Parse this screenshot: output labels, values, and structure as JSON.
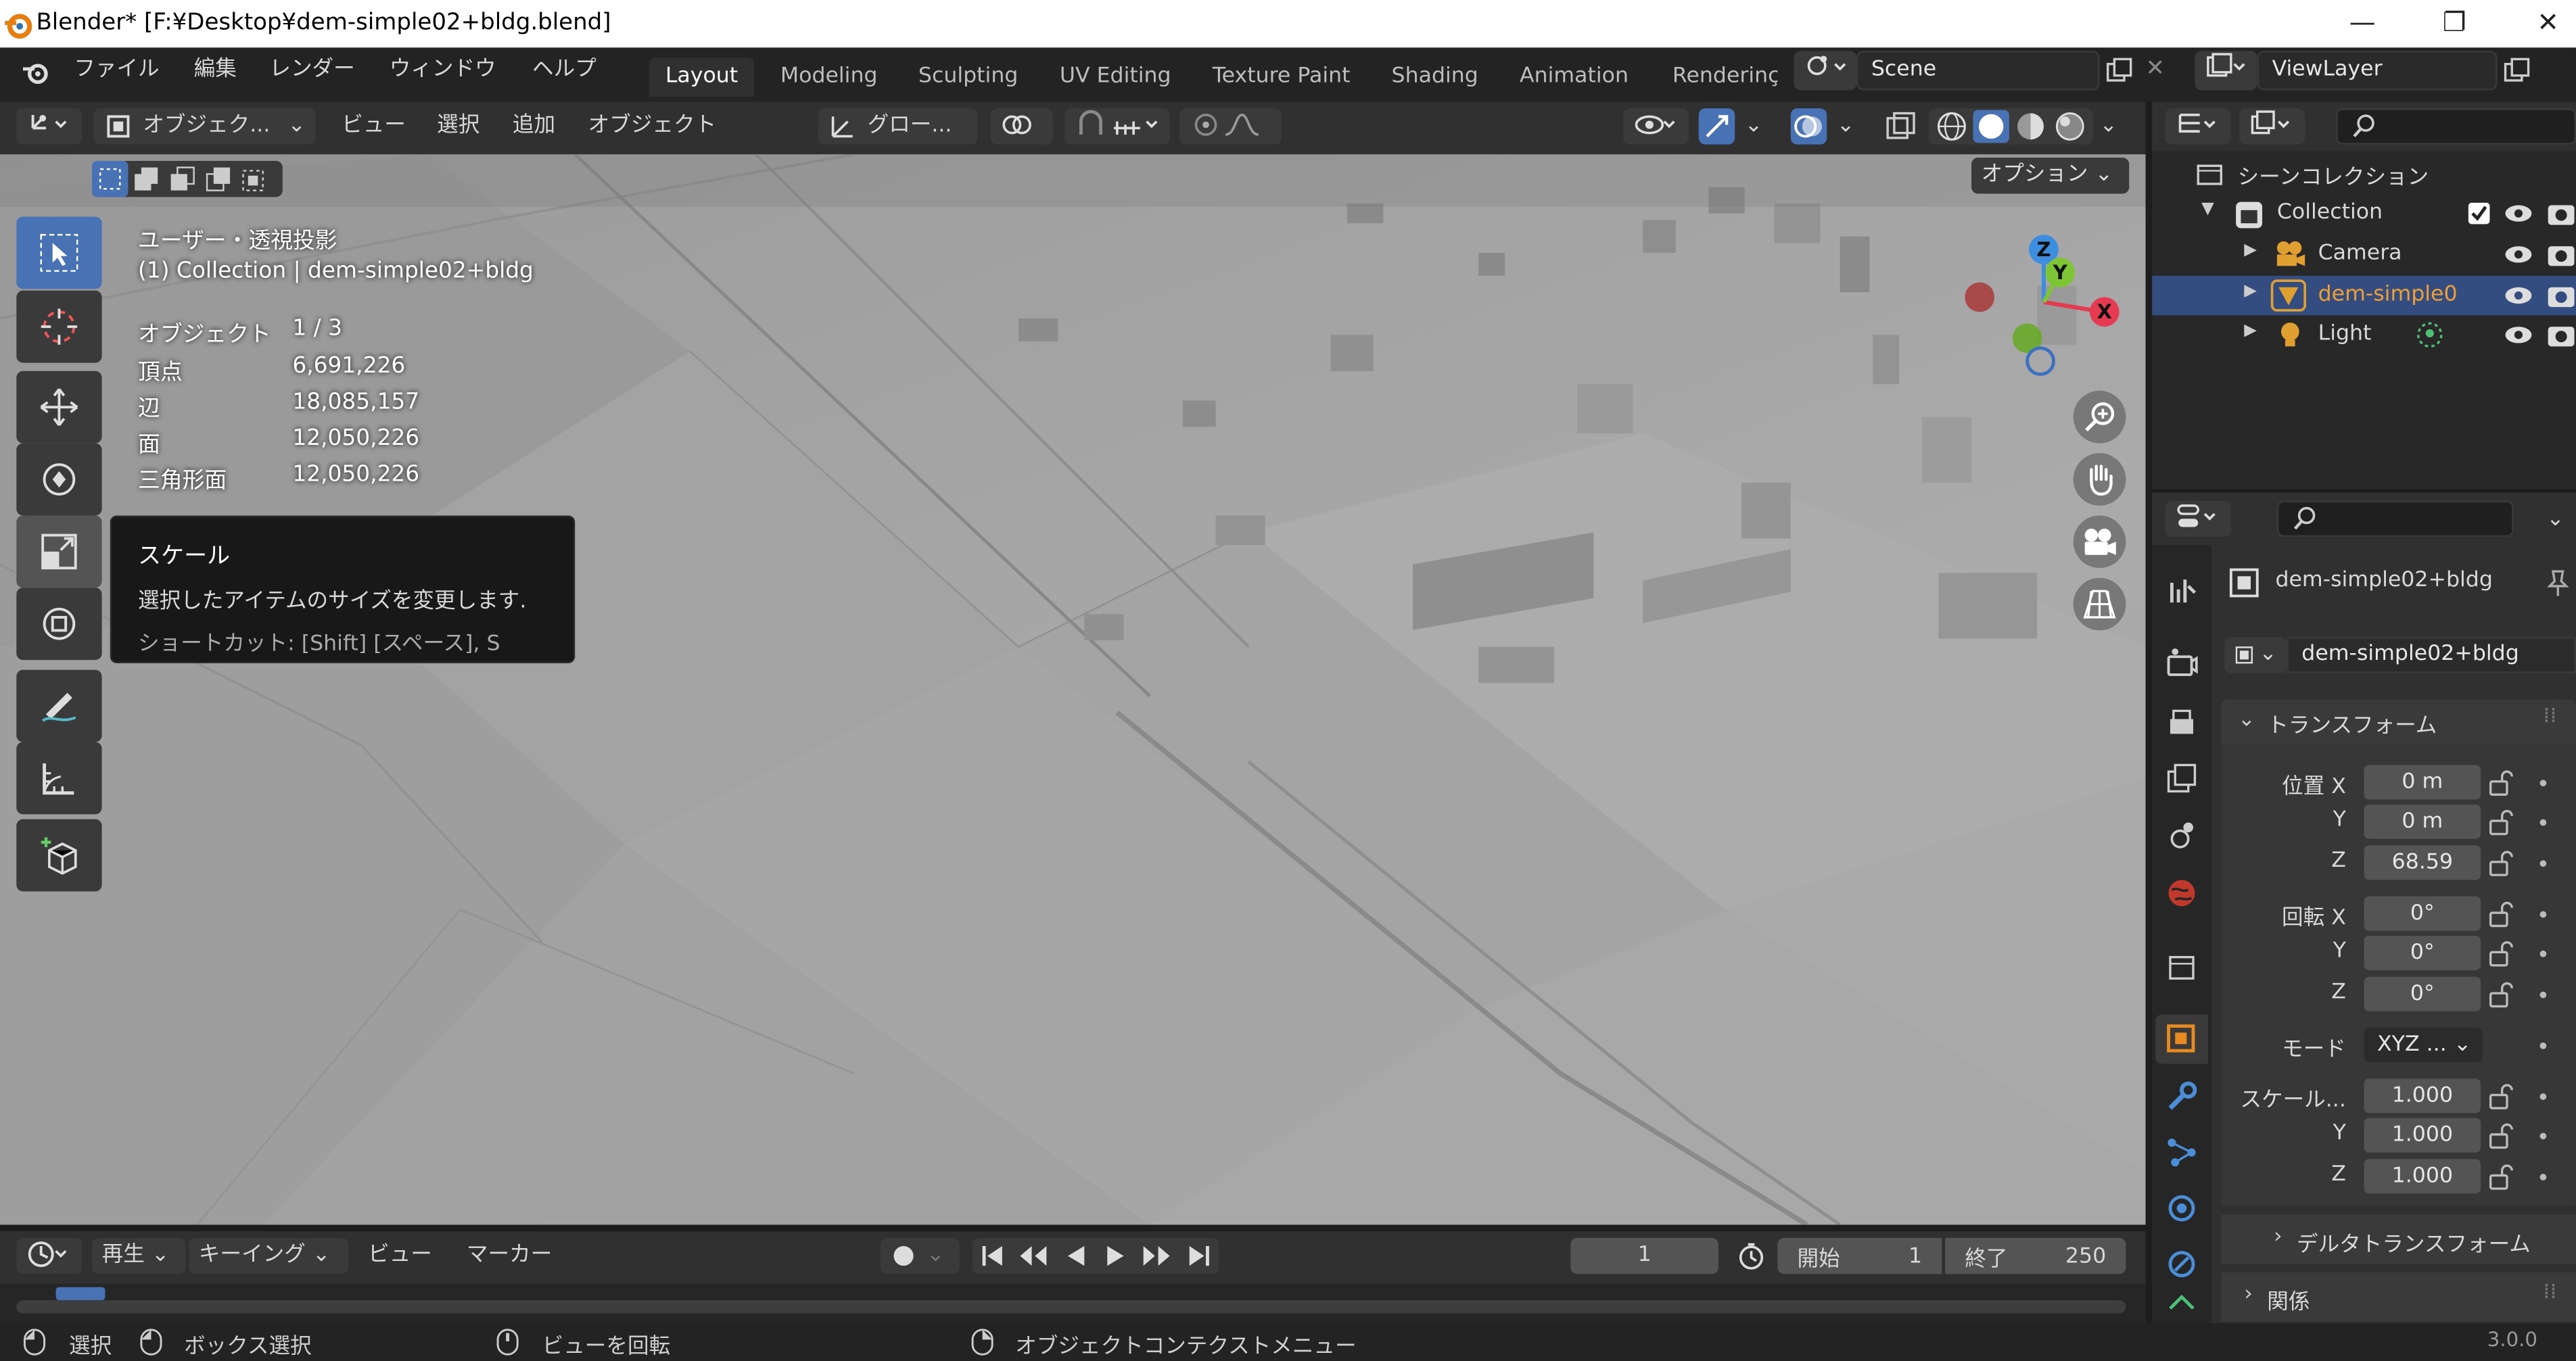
{
  "window": {
    "title": "Blender* [F:¥Desktop¥dem-simple02+bldg.blend]",
    "controls": {
      "minimize": "—",
      "maximize": "❐",
      "close": "✕"
    }
  },
  "menubar": {
    "items": [
      "ファイル",
      "編集",
      "レンダー",
      "ウィンドウ",
      "ヘルプ"
    ]
  },
  "workspaces": {
    "tabs": [
      "Layout",
      "Modeling",
      "Sculpting",
      "UV Editing",
      "Texture Paint",
      "Shading",
      "Animation",
      "Renderinç"
    ],
    "active": "Layout"
  },
  "scene": {
    "name": "Scene"
  },
  "view_layer": {
    "name": "ViewLayer"
  },
  "viewport_header": {
    "mode": "オブジェク...",
    "menus": [
      "ビュー",
      "選択",
      "追加",
      "オブジェクト"
    ],
    "transform_orientation": "グロー...",
    "options": "オプション"
  },
  "viewport_info": {
    "view_name": "ユーザー・透視投影",
    "collection_line": "(1) Collection | dem-simple02+bldg",
    "stats": [
      {
        "label": "オブジェクト",
        "value": "1 / 3"
      },
      {
        "label": "頂点",
        "value": "6,691,226"
      },
      {
        "label": "辺",
        "value": "18,085,157"
      },
      {
        "label": "面",
        "value": "12,050,226"
      },
      {
        "label": "三角形面",
        "value": "12,050,226"
      }
    ]
  },
  "tooltip": {
    "title": "スケール",
    "description": "選択したアイテムのサイズを変更します.",
    "shortcut": "ショートカット: [Shift] [スペース], S"
  },
  "gizmo": {
    "x": "X",
    "y": "Y",
    "z": "Z",
    "x_color": "#e53a4f",
    "y_color": "#7ec534",
    "z_color": "#3c8fe0"
  },
  "outliner": {
    "root": "シーンコレクション",
    "collection": "Collection",
    "items": [
      {
        "name": "Camera",
        "icon": "camera-icon",
        "selected": false
      },
      {
        "name": "dem-simple0",
        "icon": "mesh-icon",
        "selected": true
      },
      {
        "name": "Light",
        "icon": "light-icon",
        "selected": false
      }
    ]
  },
  "properties": {
    "object_name": "dem-simple02+bldg",
    "data_name": "dem-simple02+bldg",
    "transform_panel": "トランスフォーム",
    "location": {
      "label": "位置 X",
      "x": "0 m",
      "y": "0 m",
      "z": "68.59"
    },
    "rotation": {
      "label": "回転 X",
      "x": "0°",
      "y": "0°",
      "z": "0°"
    },
    "mode_label": "モード",
    "mode_value": "XYZ ...",
    "scale": {
      "label": "スケール...",
      "x": "1.000",
      "y": "1.000",
      "z": "1.000"
    },
    "axis_y": "Y",
    "axis_z": "Z",
    "delta_panel": "デルタトランスフォーム",
    "relations_panel": "関係"
  },
  "timeline": {
    "menus": [
      "再生",
      "キーイング",
      "ビュー",
      "マーカー"
    ],
    "current_frame": "1",
    "start_label": "開始",
    "start": "1",
    "end_label": "終了",
    "end": "250"
  },
  "statusbar": {
    "select": "選択",
    "box_select": "ボックス選択",
    "rotate_view": "ビューを回転",
    "context_menu": "オブジェクトコンテクストメニュー",
    "version": "3.0.0"
  },
  "colors": {
    "accent": "#4772b3",
    "selected_text": "#f0a030"
  }
}
